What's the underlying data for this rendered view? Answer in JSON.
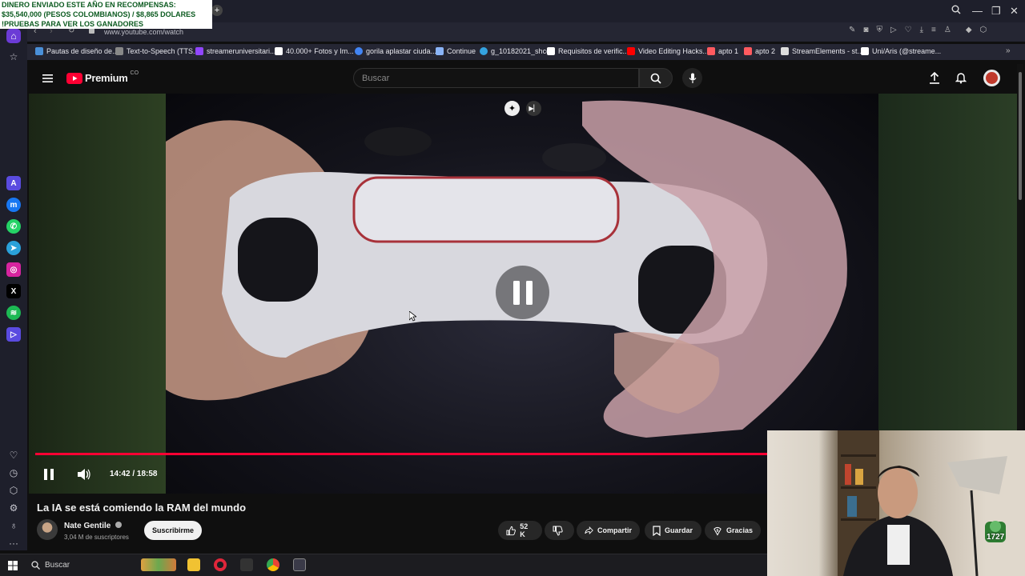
{
  "promo_banner": {
    "line1": "DINERO ENVIADO ESTE AÑO EN RECOMPENSAS:",
    "line2": "$35,540,000 (PESOS COLOMBIANOS) / $8,865 DOLARES",
    "line3": "!PRUEBAS PARA VER LOS GANADORES"
  },
  "browser": {
    "url": "www.youtube.com/watch",
    "bookmarks": [
      {
        "label": "Pautas de diseño de...",
        "color": "#4a90d9"
      },
      {
        "label": "Text-to-Speech (TTS...",
        "color": "#888888"
      },
      {
        "label": "streameruniversitari...",
        "color": "#9146ff"
      },
      {
        "label": "40.000+ Fotos y Im...",
        "color": "#ffffff"
      },
      {
        "label": "gorila aplastar ciuda...",
        "color": "#4285f4"
      },
      {
        "label": "Continue",
        "color": "#8ab4f8"
      },
      {
        "label": "g_10182021_shcc",
        "color": "#34a3e0"
      },
      {
        "label": "Requisitos de verific...",
        "color": "#ffffff"
      },
      {
        "label": "Video Editing Hacks...",
        "color": "#ff0000"
      },
      {
        "label": "apto 1",
        "color": "#ff5a5f"
      },
      {
        "label": "apto 2",
        "color": "#ff5a5f"
      },
      {
        "label": "StreamElements - st...",
        "color": "#dddddd"
      },
      {
        "label": "Uni/Aris (@streame...",
        "color": "#ffffff"
      }
    ]
  },
  "youtube": {
    "logo_text": "Premium",
    "country_code": "CO",
    "search_placeholder": "Buscar",
    "video": {
      "time_display": "14:42 / 18:58",
      "progress_fraction": 0.775,
      "title": "La IA se está comiendo la RAM del mundo"
    },
    "channel": {
      "name": "Nate Gentile",
      "subscribers": "3,04 M de suscriptores",
      "subscribe_label": "Suscribirme"
    },
    "actions": {
      "likes": "52 K",
      "share": "Compartir",
      "save": "Guardar",
      "thanks": "Gracias"
    }
  },
  "taskbar": {
    "search_label": "Buscar"
  },
  "webcam": {
    "badge": "1727"
  }
}
